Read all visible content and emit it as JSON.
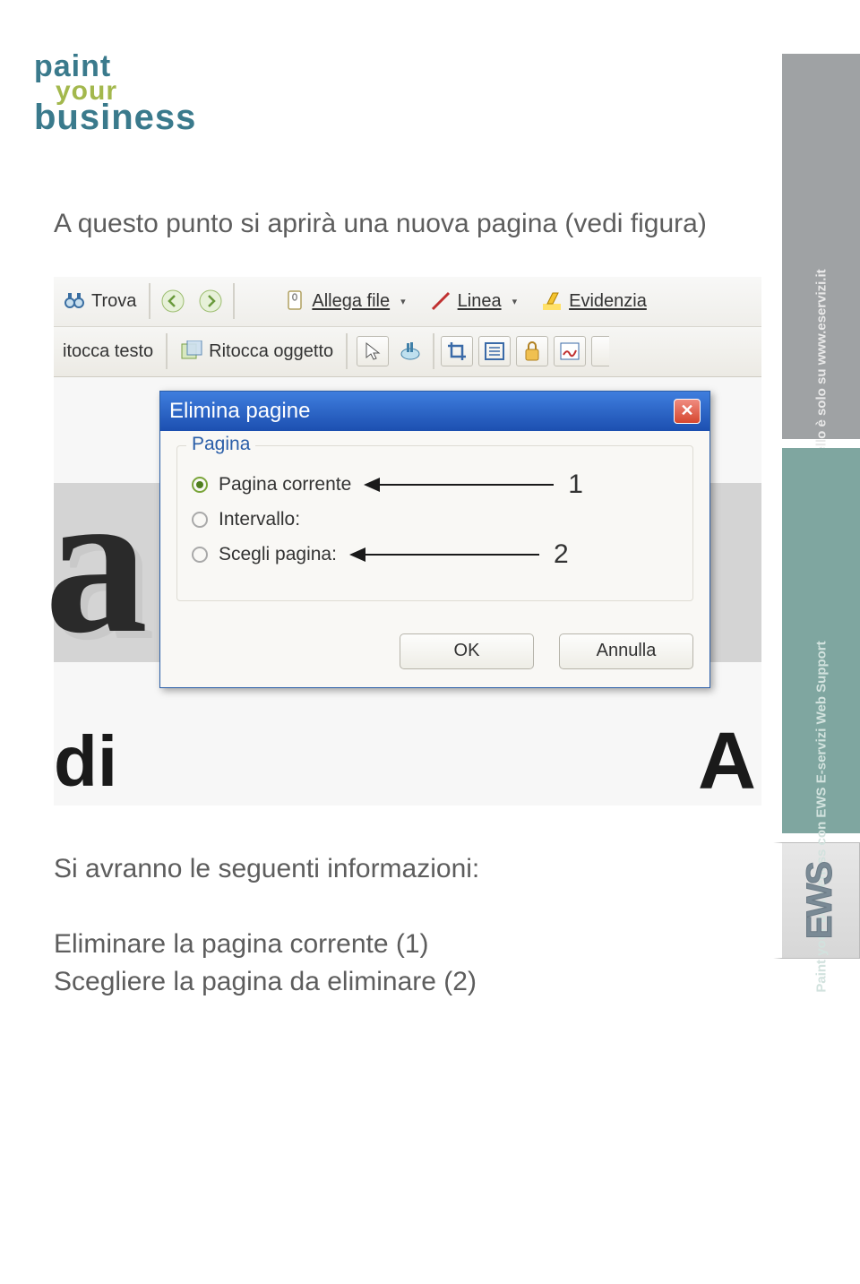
{
  "logo": {
    "line1": "paint",
    "line2": "your",
    "line3": "business"
  },
  "sidebar": {
    "tag1": "Il tuo fiore all'occhiello è solo su www.eservizi.it",
    "tag2": "Paint your busineness con EWS E-servizi Web Support",
    "ews": "EWS"
  },
  "intro": "A questo punto si aprirà una nuova pagina (vedi figura)",
  "toolbar1": {
    "find": "Trova",
    "attach": "Allega file",
    "line": "Linea",
    "highlight": "Evidenzia"
  },
  "toolbar2": {
    "touch_text": "itocca testo",
    "touch_obj": "Ritocca oggetto"
  },
  "dialog": {
    "title": "Elimina pagine",
    "group": "Pagina",
    "opt_current": "Pagina corrente",
    "opt_range": "Intervallo:",
    "opt_choose": "Scegli pagina:",
    "num1": "1",
    "num2": "2",
    "ok": "OK",
    "cancel": "Annulla"
  },
  "bg": {
    "di": "di",
    "A": "A"
  },
  "outro": {
    "line1": "Si avranno le seguenti informazioni:",
    "line2": "Eliminare la pagina corrente (1)",
    "line3": "Scegliere la pagina da eliminare (2)"
  }
}
